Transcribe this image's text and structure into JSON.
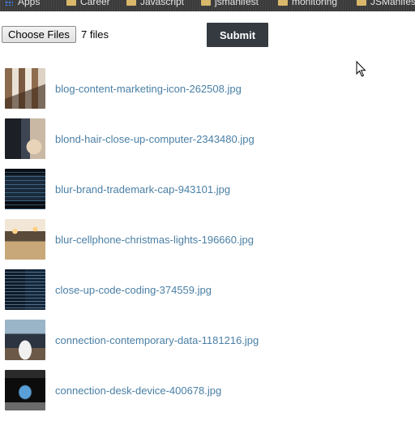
{
  "bookmarks_bar": {
    "items": [
      {
        "label": "Apps",
        "icon": "apps-grid-icon"
      },
      {
        "label": "Career",
        "icon": "folder-icon"
      },
      {
        "label": "Javascript",
        "icon": "folder-icon"
      },
      {
        "label": "jsmanifest",
        "icon": "folder-icon"
      },
      {
        "label": "monitoring",
        "icon": "folder-icon"
      },
      {
        "label": "JSManifest",
        "icon": "folder-icon"
      }
    ]
  },
  "upload": {
    "choose_files_label": "Choose Files",
    "file_count_text": "7 files",
    "submit_label": "Submit"
  },
  "files": [
    {
      "name": "blog-content-marketing-icon-262508.jpg"
    },
    {
      "name": "blond-hair-close-up-computer-2343480.jpg"
    },
    {
      "name": "blur-brand-trademark-cap-943101.jpg"
    },
    {
      "name": "blur-cellphone-christmas-lights-196660.jpg"
    },
    {
      "name": "close-up-code-coding-374559.jpg"
    },
    {
      "name": "connection-contemporary-data-1181216.jpg"
    },
    {
      "name": "connection-desk-device-400678.jpg"
    }
  ],
  "colors": {
    "submit_background": "#343a40",
    "link": "#4a7fa5",
    "bookmarks_bar": "#3a3a3a"
  }
}
